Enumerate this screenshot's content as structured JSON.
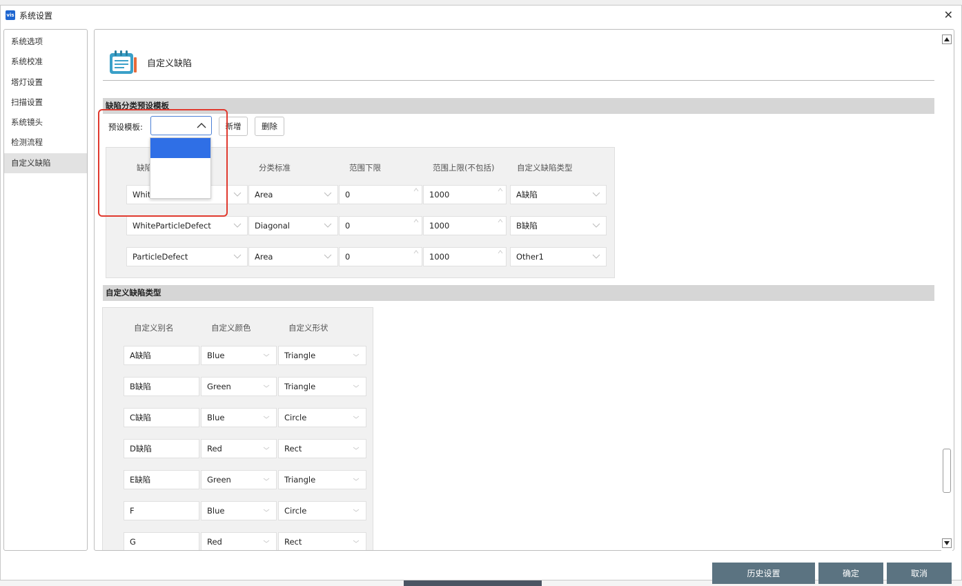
{
  "window": {
    "title": "系统设置",
    "app_icon_text": "vis"
  },
  "sidebar": {
    "items": [
      {
        "label": "系统选项"
      },
      {
        "label": "系统校准"
      },
      {
        "label": "塔灯设置"
      },
      {
        "label": "扫描设置"
      },
      {
        "label": "系统镜头"
      },
      {
        "label": "检测流程"
      },
      {
        "label": "自定义缺陷",
        "active": true
      }
    ]
  },
  "header": {
    "title": "自定义缺陷",
    "icon": "calendar-edit-icon"
  },
  "preset_section": {
    "title": "缺陷分类预设模板",
    "preset_label": "预设模板:",
    "preset_value": "",
    "add_label": "新增",
    "delete_label": "删除",
    "dropdown_open": true,
    "dropdown_options": [
      "",
      "",
      ""
    ],
    "columns": [
      "缺陷",
      "分类标准",
      "范围下限",
      "范围上限(不包括)",
      "自定义缺陷类型"
    ],
    "rows": [
      {
        "defect": "White",
        "criterion": "Area",
        "min": "0",
        "max": "1000",
        "type": "A缺陷"
      },
      {
        "defect": "WhiteParticleDefect",
        "criterion": "Diagonal",
        "min": "0",
        "max": "1000",
        "type": "B缺陷"
      },
      {
        "defect": "ParticleDefect",
        "criterion": "Area",
        "min": "0",
        "max": "1000",
        "type": "Other1"
      }
    ]
  },
  "custom_section": {
    "title": "自定义缺陷类型",
    "columns": [
      "自定义别名",
      "自定义颜色",
      "自定义形状"
    ],
    "rows": [
      {
        "alias": "A缺陷",
        "color": "Blue",
        "shape": "Triangle"
      },
      {
        "alias": "B缺陷",
        "color": "Green",
        "shape": "Triangle"
      },
      {
        "alias": "C缺陷",
        "color": "Blue",
        "shape": "Circle"
      },
      {
        "alias": "D缺陷",
        "color": "Red",
        "shape": "Rect"
      },
      {
        "alias": "E缺陷",
        "color": "Green",
        "shape": "Triangle"
      },
      {
        "alias": "F",
        "color": "Blue",
        "shape": "Circle"
      },
      {
        "alias": "G",
        "color": "Red",
        "shape": "Rect"
      }
    ]
  },
  "footer": {
    "history_label": "历史设置",
    "ok_label": "确定",
    "cancel_label": "取消"
  },
  "colors": {
    "accent": "#2f6fe6",
    "footer_button": "#5b7381",
    "highlight": "#e0392e"
  }
}
